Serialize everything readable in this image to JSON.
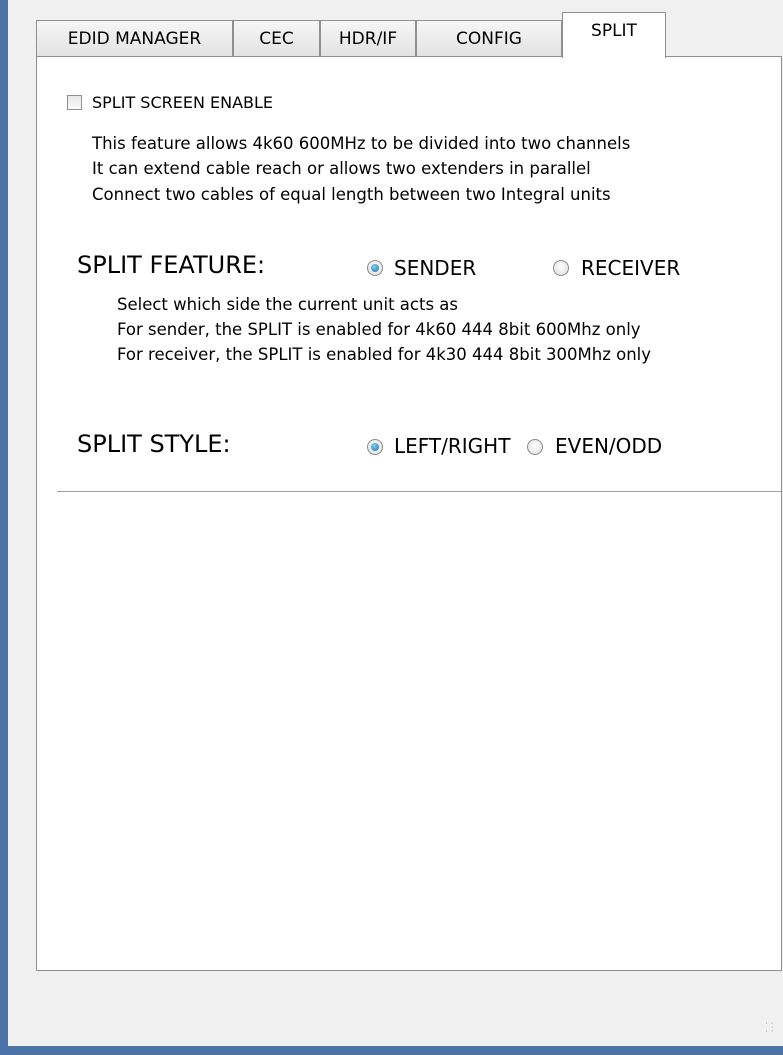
{
  "tabs": [
    {
      "label": "EDID MANAGER"
    },
    {
      "label": "CEC"
    },
    {
      "label": "HDR/IF"
    },
    {
      "label": "CONFIG"
    },
    {
      "label": "SPLIT"
    }
  ],
  "active_tab": "SPLIT",
  "split_enable": {
    "label": "SPLIT SCREEN ENABLE",
    "checked": false,
    "description": [
      "This feature allows 4k60 600MHz to be divided into two channels",
      "It can extend cable reach or allows two extenders in parallel",
      "Connect two cables of equal length between two Integral units"
    ]
  },
  "split_feature": {
    "heading": "SPLIT FEATURE:",
    "options": [
      {
        "label": "SENDER",
        "checked": true
      },
      {
        "label": "RECEIVER",
        "checked": false
      }
    ],
    "description": [
      "Select which side the current unit acts as",
      "For sender, the SPLIT is enabled for 4k60 444 8bit 600Mhz only",
      "For receiver, the SPLIT is enabled for 4k30 444 8bit 300Mhz only"
    ]
  },
  "split_style": {
    "heading": "SPLIT STYLE:",
    "options": [
      {
        "label": "LEFT/RIGHT",
        "checked": true
      },
      {
        "label": "EVEN/ODD",
        "checked": false
      }
    ]
  },
  "icons": {
    "resize_grip": "resize-grip-icon"
  }
}
